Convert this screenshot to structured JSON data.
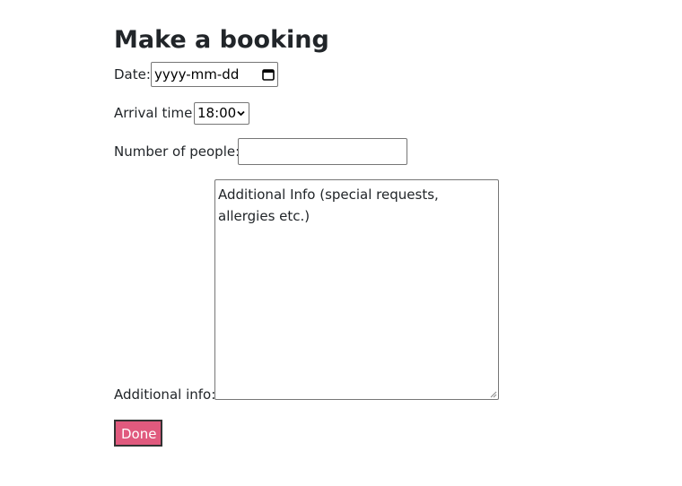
{
  "page": {
    "title": "Make a booking"
  },
  "form": {
    "date": {
      "label": "Date:",
      "placeholder": "yyyy-mm-dd",
      "icon": "calendar-icon"
    },
    "arrival_time": {
      "label": "Arrival time:",
      "selected": "18:00",
      "icon": "chevron-down-icon"
    },
    "people": {
      "label": "Number of people:",
      "value": ""
    },
    "additional_info": {
      "label": "Additional info:",
      "placeholder": "Additional Info (special requests, allergies etc.)"
    },
    "submit": {
      "label": "Done",
      "color": "#e05a7e"
    }
  }
}
